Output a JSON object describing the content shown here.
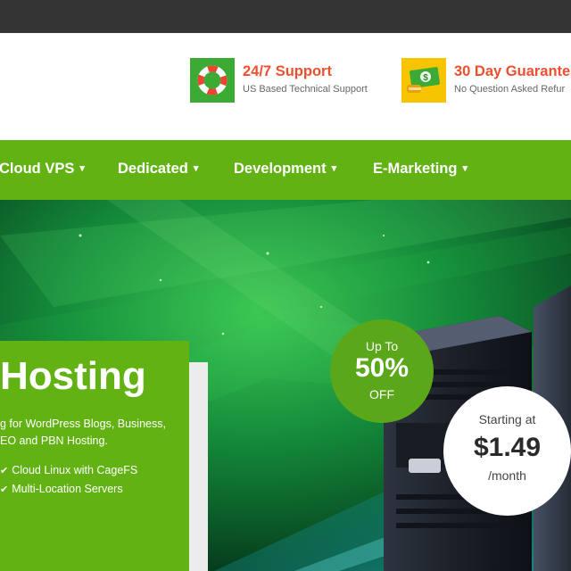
{
  "header": {
    "features": [
      {
        "title": "24/7 Support",
        "subtitle": "US Based Technical Support",
        "icon": "lifebuoy-icon",
        "icon_bg": "#3cab36"
      },
      {
        "title": "30 Day Guarante",
        "subtitle": "No Question Asked Refur",
        "icon": "money-back-icon",
        "icon_bg": "#f6c400"
      }
    ]
  },
  "nav": {
    "items": [
      {
        "label": "Cloud VPS"
      },
      {
        "label": "Dedicated"
      },
      {
        "label": "Development"
      },
      {
        "label": "E-Marketing"
      }
    ],
    "caret": "▾"
  },
  "hero": {
    "title": "Hosting",
    "description_lines": [
      "g for WordPress Blogs, Business,",
      "EO and PBN Hosting."
    ],
    "features": [
      "Cloud Linux with CageFS",
      "Multi-Location Servers"
    ],
    "check": "✔",
    "discount": {
      "line1": "Up To",
      "line2": "50%",
      "line3": "OFF"
    },
    "price": {
      "line1": "Starting at",
      "line2": "$1.49",
      "line3": "/month"
    }
  },
  "colors": {
    "brand_green": "#62b214",
    "accent_orange": "#ef4f2f",
    "topbar": "#343434"
  }
}
